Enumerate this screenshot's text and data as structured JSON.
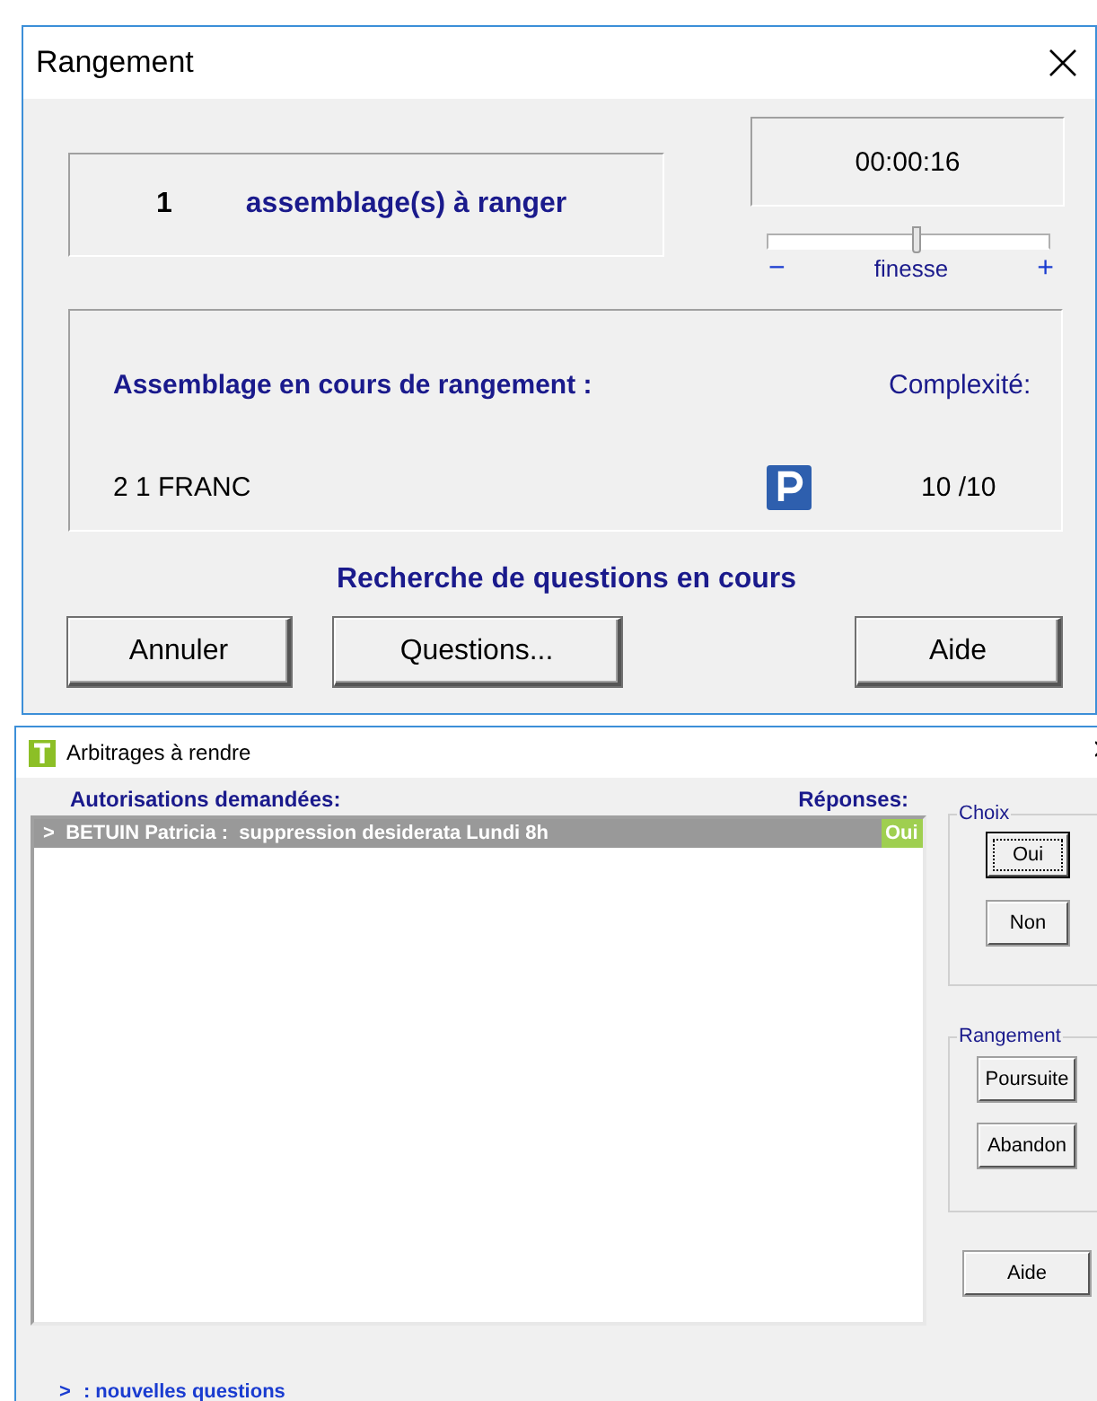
{
  "rangement": {
    "title": "Rangement",
    "count": "1",
    "count_label": "assemblage(s) à ranger",
    "timer": "00:00:16",
    "finesse": {
      "minus": "−",
      "label": "finesse",
      "plus": "+",
      "level": 0.53
    },
    "current": {
      "heading": "Assemblage en cours de rangement :",
      "name": "2 1 FRANC",
      "complexity_label": "Complexité:",
      "complexity": "10 /10"
    },
    "status": "Recherche de questions en cours",
    "buttons": [
      "Annuler",
      "Questions...",
      "Aide"
    ]
  },
  "arbitrages": {
    "title": "Arbitrages à rendre",
    "columns": [
      "Autorisations demandées:",
      "Réponses:"
    ],
    "rows": [
      {
        "marker": ">",
        "text": "BETUIN Patricia :  suppression desiderata Lundi 8h",
        "answer": "Oui",
        "selected": true
      }
    ],
    "choix": {
      "label": "Choix",
      "buttons": [
        {
          "label": "Oui",
          "default": true
        },
        {
          "label": "Non",
          "default": false
        }
      ]
    },
    "rangement": {
      "label": "Rangement",
      "buttons": [
        "Poursuite",
        "Abandon"
      ]
    },
    "help": "Aide",
    "legend": {
      "marker": ">",
      "text": ": nouvelles questions"
    }
  }
}
